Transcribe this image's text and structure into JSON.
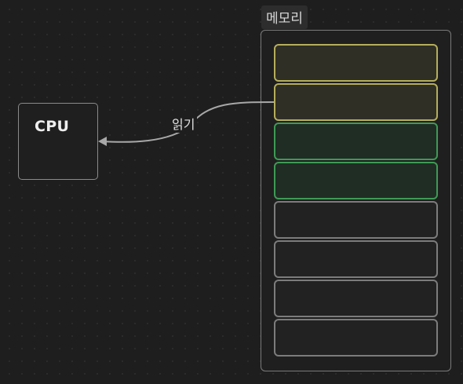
{
  "cpu": {
    "label": "CPU"
  },
  "memory": {
    "title": "메모리",
    "cells": [
      {
        "state": "highlight-read"
      },
      {
        "state": "highlight-read"
      },
      {
        "state": "highlight-active"
      },
      {
        "state": "highlight-active"
      },
      {
        "state": "empty"
      },
      {
        "state": "empty"
      },
      {
        "state": "empty"
      },
      {
        "state": "empty"
      }
    ]
  },
  "edge": {
    "label": "읽기",
    "direction": "memory-to-cpu"
  },
  "colors": {
    "background": "#1e1e1e",
    "highlight_read_border": "#b5ae5c",
    "highlight_active_border": "#3f9a55",
    "empty_border": "#7c7c7c",
    "arrow": "#a8a8a8"
  }
}
